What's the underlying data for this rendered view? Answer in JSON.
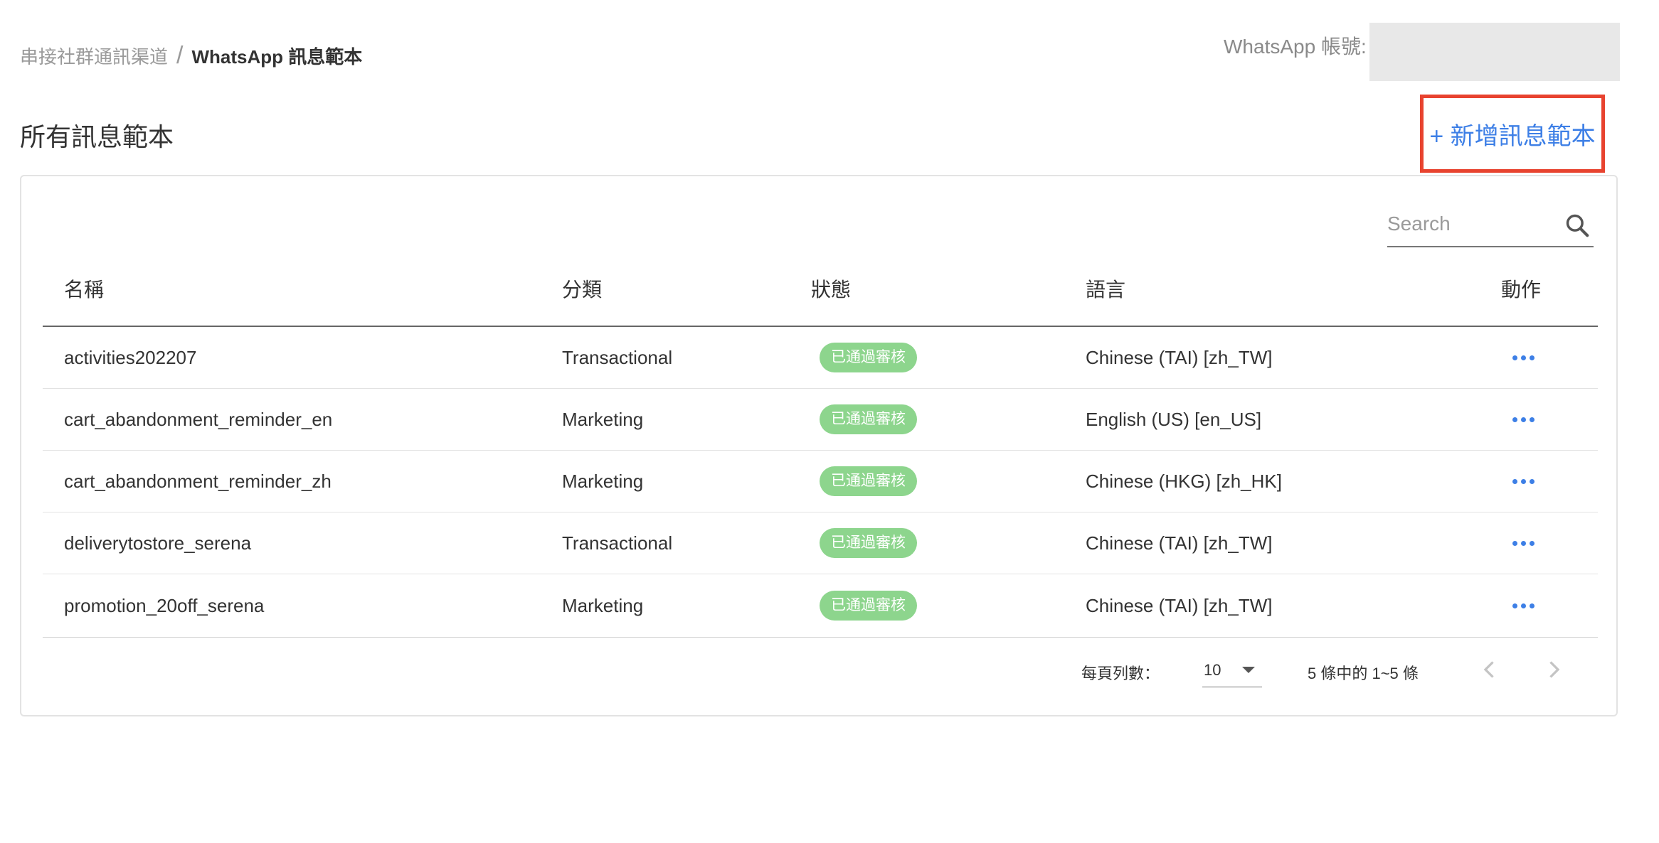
{
  "breadcrumb": {
    "parent": "串接社群通訊渠道",
    "separator": "/",
    "current": "WhatsApp 訊息範本"
  },
  "account": {
    "label": "WhatsApp 帳號:",
    "value": ""
  },
  "section": {
    "title": "所有訊息範本",
    "add_button_label": "+ 新增訊息範本"
  },
  "search": {
    "placeholder": "Search",
    "icon": "search-icon"
  },
  "table": {
    "headers": {
      "name": "名稱",
      "category": "分類",
      "status": "狀態",
      "language": "語言",
      "actions": "動作"
    },
    "rows": [
      {
        "name": "activities202207",
        "category": "Transactional",
        "status": "已通過審核",
        "language": "Chinese (TAI) [zh_TW]"
      },
      {
        "name": "cart_abandonment_reminder_en",
        "category": "Marketing",
        "status": "已通過審核",
        "language": "English (US) [en_US]"
      },
      {
        "name": "cart_abandonment_reminder_zh",
        "category": "Marketing",
        "status": "已通過審核",
        "language": "Chinese (HKG) [zh_HK]"
      },
      {
        "name": "deliverytostore_serena",
        "category": "Transactional",
        "status": "已通過審核",
        "language": "Chinese (TAI) [zh_TW]"
      },
      {
        "name": "promotion_20off_serena",
        "category": "Marketing",
        "status": "已通過審核",
        "language": "Chinese (TAI) [zh_TW]"
      }
    ]
  },
  "pagination": {
    "rows_per_page_label": "每頁列數：",
    "rows_per_page_value": "10",
    "range_text": "5 條中的 1~5 條"
  },
  "colors": {
    "accent": "#3d7fe6",
    "highlight_border": "#e8432f",
    "status_badge": "#8dd58d"
  }
}
